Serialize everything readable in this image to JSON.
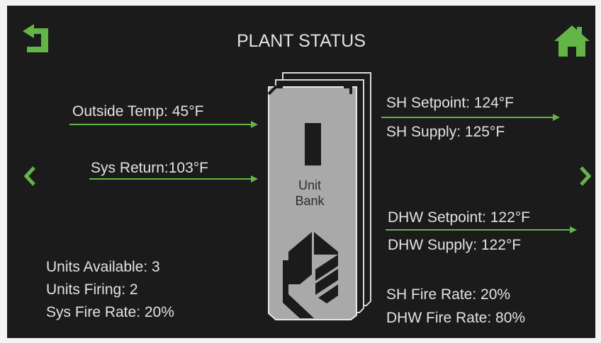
{
  "header": {
    "title": "PLANT STATUS",
    "back_icon": "back-arrow-icon",
    "home_icon": "home-icon"
  },
  "nav": {
    "prev_icon": "chevron-left-icon",
    "next_icon": "chevron-right-icon"
  },
  "inputs": {
    "outside_temp": "Outside Temp: 45°F",
    "sys_return": "Sys Return:103°F"
  },
  "unit_bank": {
    "line1": "Unit",
    "line2": "Bank"
  },
  "sh": {
    "setpoint": "SH Setpoint: 124°F",
    "supply": "SH Supply: 125°F"
  },
  "dhw": {
    "setpoint": "DHW Setpoint: 122°F",
    "supply": "DHW Supply: 122°F"
  },
  "units": {
    "available": "Units Available: 3",
    "firing": "Units Firing: 2",
    "sys_fire_rate": "Sys Fire Rate: 20%"
  },
  "fire_rates": {
    "sh": "SH Fire Rate: 20%",
    "dhw": "DHW Fire Rate: 80%"
  },
  "colors": {
    "accent": "#63b547",
    "background": "#1b1b1b",
    "text": "#e2e2e2",
    "unit_fill": "#a9a9a9"
  }
}
